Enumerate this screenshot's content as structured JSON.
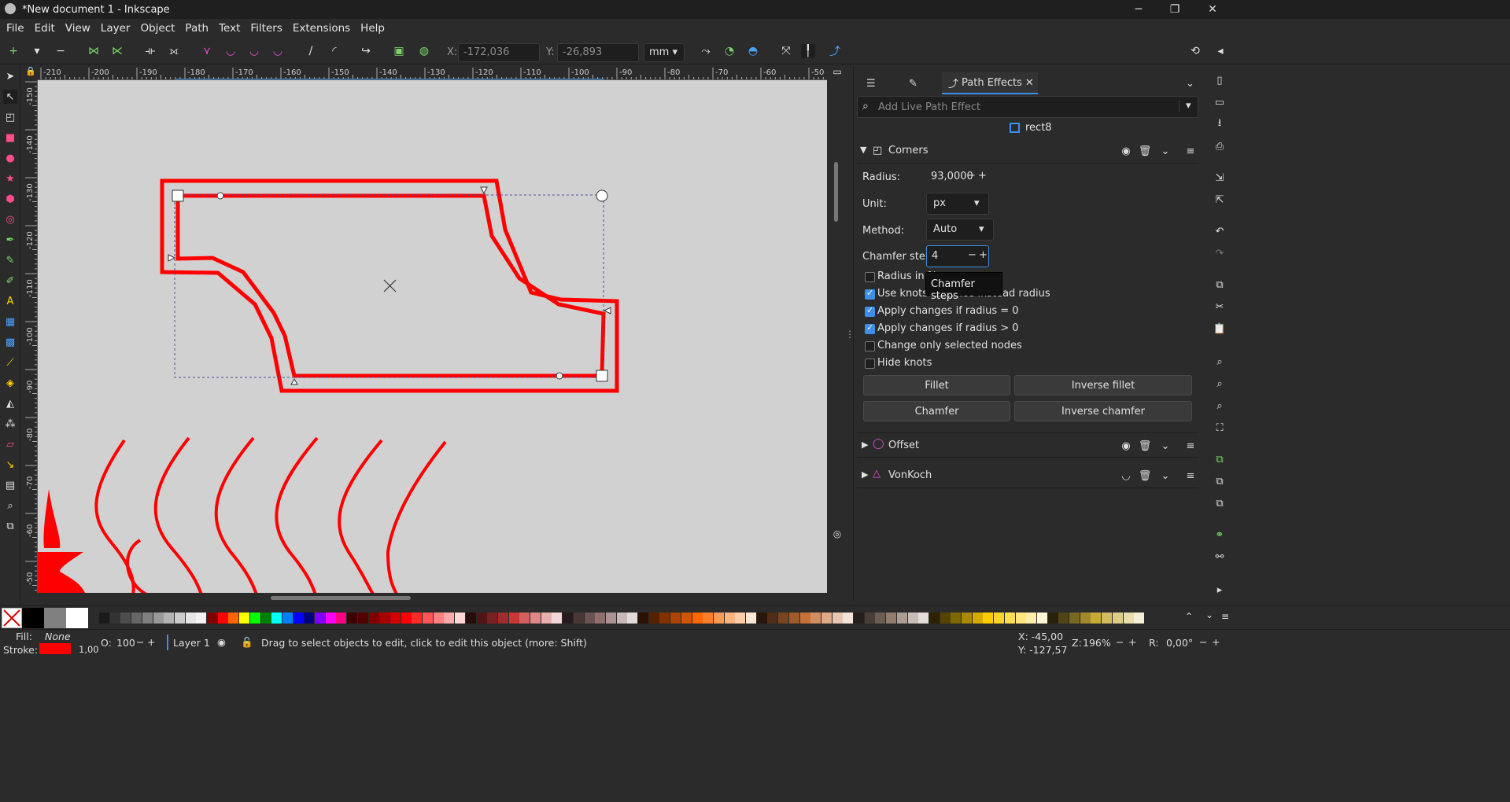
{
  "window": {
    "title": "*New document 1 - Inkscape"
  },
  "menu": [
    "File",
    "Edit",
    "View",
    "Layer",
    "Object",
    "Path",
    "Text",
    "Filters",
    "Extensions",
    "Help"
  ],
  "toolbar": {
    "x_label": "X:",
    "x_value": "-172,036",
    "y_label": "Y:",
    "y_value": "-26,893",
    "unit": "mm"
  },
  "ruler": {
    "h_ticks": [
      "-210",
      "-200",
      "-190",
      "-180",
      "-170",
      "-160",
      "-150",
      "-140",
      "-130",
      "-120",
      "-110",
      "-100",
      "-90",
      "-80",
      "-70",
      "-60",
      "-50"
    ],
    "v_ticks": [
      "-150",
      "-140",
      "-130",
      "-120",
      "-110",
      "-100",
      "-90",
      "-80",
      "-70",
      "-60",
      "-50"
    ]
  },
  "dock": {
    "tab_label": "Path Effects",
    "search_placeholder": "Add Live Path Effect",
    "object_name": "rect8",
    "effects": [
      {
        "name": "Corners",
        "expanded": true
      },
      {
        "name": "Offset",
        "expanded": false
      },
      {
        "name": "VonKoch",
        "expanded": false
      }
    ],
    "corners": {
      "radius_label": "Radius:",
      "radius_value": "93,0000",
      "unit_label": "Unit:",
      "unit_value": "px",
      "method_label": "Method:",
      "method_value": "Auto",
      "chamfer_label": "Chamfer steps:",
      "chamfer_value": "4",
      "checkboxes": [
        {
          "label": "Radius in %",
          "checked": false
        },
        {
          "label": "Use knots distance instead radius",
          "checked": true
        },
        {
          "label": "Apply changes if radius = 0",
          "checked": true
        },
        {
          "label": "Apply changes if radius > 0",
          "checked": true
        },
        {
          "label": "Change only selected nodes",
          "checked": false
        },
        {
          "label": "Hide knots",
          "checked": false
        }
      ],
      "buttons": [
        "Fillet",
        "Inverse fillet",
        "Chamfer",
        "Inverse chamfer"
      ]
    },
    "tooltip": "Chamfer steps"
  },
  "status": {
    "fill_label": "Fill:",
    "fill_value": "None",
    "stroke_label": "Stroke:",
    "stroke_width": "1,00",
    "opacity_label": "O:",
    "opacity_value": "100",
    "layer": "Layer 1",
    "message": "Drag to select objects to edit, click to edit this object (more: Shift)",
    "cursor_x": "X: -45,00",
    "cursor_y": "Y: -127,57",
    "zoom_label": "Z:",
    "zoom_value": "196%",
    "rotate_label": "R:",
    "rotate_value": "0,00°"
  },
  "colors": {
    "accent": "#3d8fe8",
    "stroke_red": "#ff0000"
  }
}
